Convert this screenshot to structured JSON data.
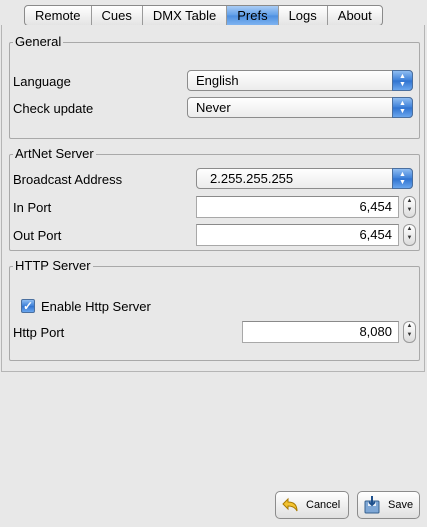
{
  "tabs": [
    {
      "label": "Remote"
    },
    {
      "label": "Cues"
    },
    {
      "label": "DMX Table"
    },
    {
      "label": "Prefs"
    },
    {
      "label": "Logs"
    },
    {
      "label": "About"
    }
  ],
  "active_tab": "Prefs",
  "general": {
    "title": "General",
    "language_label": "Language",
    "language_value": "English",
    "check_update_label": "Check update",
    "check_update_value": "Never"
  },
  "artnet": {
    "title": "ArtNet Server",
    "broadcast_label": "Broadcast Address",
    "broadcast_value": "2.255.255.255",
    "in_port_label": "In Port",
    "in_port_value": "6,454",
    "out_port_label": "Out Port",
    "out_port_value": "6,454"
  },
  "http": {
    "title": "HTTP Server",
    "enable_label": "Enable Http Server",
    "enable_checked": true,
    "port_label": "Http Port",
    "port_value": "8,080"
  },
  "buttons": {
    "cancel_label": "Cancel",
    "save_label": "Save"
  },
  "colors": {
    "accent": "#3c7fd8",
    "background": "#e8e8e8"
  }
}
